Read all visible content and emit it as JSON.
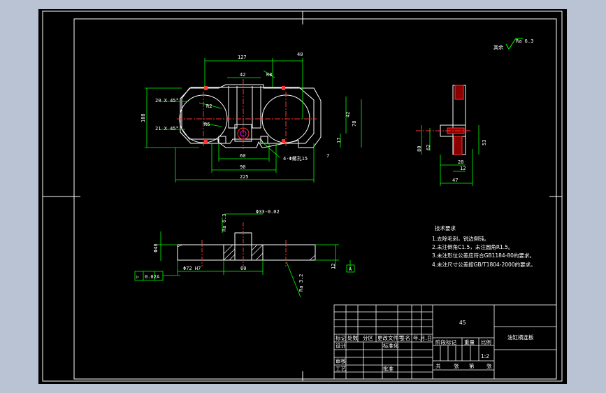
{
  "surface_finish": {
    "prefix": "其余",
    "value": "Ra 6.3"
  },
  "front_view": {
    "dim_top_left": "127",
    "dim_top_right": "40",
    "dim_center": "42",
    "dim_r_top": "R8",
    "chamfer_top": "20 X 45°",
    "chamfer_bottom": "21 X 45°",
    "dim_left_height": "108",
    "dim_r_left": "R2",
    "dim_r_mid": "R6",
    "dim_right_42": "42",
    "dim_right_78": "78",
    "dim_right_17": "17",
    "dim_right_7": "7",
    "dim_bottom_60": "60",
    "dim_bottom_90": "90",
    "dim_bottom_225": "225",
    "holes_note": "4-Φ螺孔15"
  },
  "side_view": {
    "dim_80": "80",
    "dim_62": "62",
    "dim_53": "53",
    "dim_28": "28",
    "dim_12": "12",
    "dim_47": "47"
  },
  "section_view": {
    "dim_bore": "Φ33-0.02",
    "dim_ra_top": "Ra 6.3",
    "dim_left_phi": "Φ48",
    "dim_ref_phi": "Φ72 H7",
    "dim_60": "60",
    "dim_ra_bottom": "Ra 3.2",
    "dim_12": "12",
    "datum": "A",
    "tolerance": [
      "▷",
      "0.02",
      "A"
    ]
  },
  "notes": {
    "title": "技术要求",
    "items": [
      "1.去除毛刺，锐边倒钝。",
      "2.未注倒角C1.5，未注圆角R1.5。",
      "3.未注形位公差应符合GB1184-80的要求。",
      "4.未注尺寸公差按GB/T1804-2000的要求。"
    ]
  },
  "title_block": {
    "material": "45",
    "part_name": "油缸横连板",
    "labels": {
      "mark": "标记",
      "count": "处数",
      "zone": "分区",
      "change_doc": "更改文件号",
      "signature": "签名",
      "date": "年.月.日",
      "design": "设计",
      "standardize": "标准化",
      "review": "审核",
      "process": "工艺",
      "approve": "批准",
      "stage_mark": "阶段标记",
      "weight": "重量",
      "scale": "比例",
      "total": "共",
      "sheet_word": "张",
      "page": "第",
      "sheet_word2": "张"
    },
    "scale_value": "1:2"
  }
}
